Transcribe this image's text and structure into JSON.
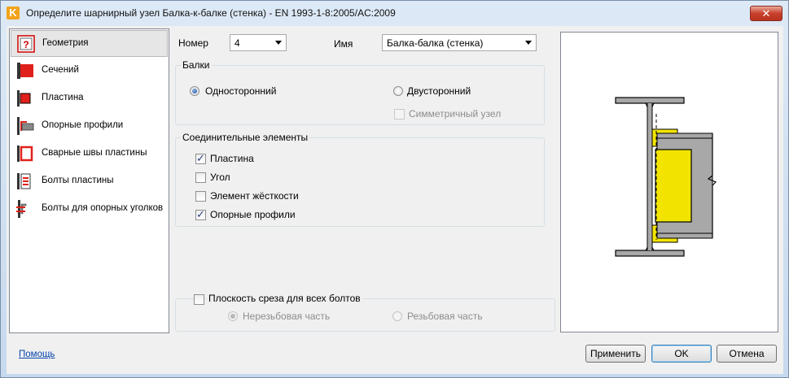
{
  "window": {
    "title": "Определите шарнирный узел Балка-к-балке (стенка) - EN 1993-1-8:2005/AC:2009",
    "app_icon_letter": "K"
  },
  "sidebar": {
    "items": [
      {
        "label": "Геометрия",
        "icon": "geometry-icon",
        "selected": true
      },
      {
        "label": "Сечений",
        "icon": "section-icon"
      },
      {
        "label": "Пластина",
        "icon": "plate-icon"
      },
      {
        "label": "Опорные профили",
        "icon": "support-profiles-icon"
      },
      {
        "label": "Сварные швы пластины",
        "icon": "plate-welds-icon"
      },
      {
        "label": "Болты пластины",
        "icon": "plate-bolts-icon"
      },
      {
        "label": "Болты для опорных уголков",
        "icon": "angle-bolts-icon"
      }
    ]
  },
  "form": {
    "number_label": "Номер",
    "number_value": "4",
    "name_label": "Имя",
    "name_value": "Балка-балка (стенка)",
    "beams": {
      "title": "Балки",
      "one_sided": "Односторонний",
      "two_sided": "Двусторонний",
      "symmetric": "Симметричный узел"
    },
    "connectors": {
      "title": "Соединительные элементы",
      "items": [
        {
          "label": "Пластина",
          "checked": true
        },
        {
          "label": "Угол",
          "checked": false
        },
        {
          "label": "Элемент жёсткости",
          "checked": false
        },
        {
          "label": "Опорные профили",
          "checked": true
        }
      ]
    },
    "shear": {
      "title": "Плоскость среза для всех болтов",
      "unthreaded": "Нерезьбовая часть",
      "threaded": "Резьбовая часть"
    }
  },
  "footer": {
    "help": "Помощь",
    "apply": "Применить",
    "ok": "OK",
    "cancel": "Отмена"
  },
  "colors": {
    "steel": "#a8a8a8",
    "plate_yellow": "#f2e400",
    "selected_icon": "#e0201b"
  }
}
